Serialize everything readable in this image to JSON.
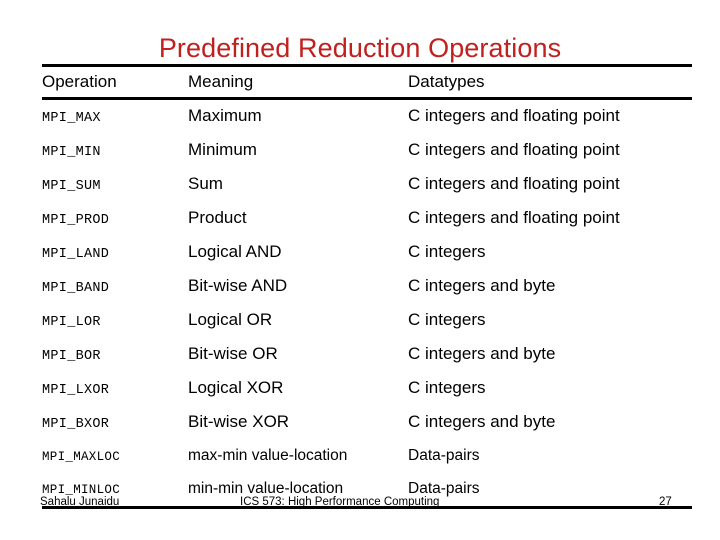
{
  "slide": {
    "title": "Predefined Reduction Operations",
    "title_color": "#C0201E",
    "text_color": "#000000",
    "background": "#FFFFFF"
  },
  "table": {
    "columns": [
      {
        "key": "operation",
        "label": "Operation"
      },
      {
        "key": "meaning",
        "label": "Meaning"
      },
      {
        "key": "datatypes",
        "label": "Datatypes"
      }
    ],
    "rows": [
      {
        "operation": "MPI_MAX",
        "meaning": "Maximum",
        "datatypes": "C integers and floating point"
      },
      {
        "operation": "MPI_MIN",
        "meaning": "Minimum",
        "datatypes": "C integers and floating point"
      },
      {
        "operation": "MPI_SUM",
        "meaning": "Sum",
        "datatypes": "C integers and floating point"
      },
      {
        "operation": "MPI_PROD",
        "meaning": "Product",
        "datatypes": "C integers and floating point"
      },
      {
        "operation": "MPI_LAND",
        "meaning": "Logical AND",
        "datatypes": "C integers"
      },
      {
        "operation": "MPI_BAND",
        "meaning": "Bit-wise AND",
        "datatypes": "C integers and byte"
      },
      {
        "operation": "MPI_LOR",
        "meaning": "Logical OR",
        "datatypes": "C integers"
      },
      {
        "operation": "MPI_BOR",
        "meaning": "Bit-wise OR",
        "datatypes": "C integers and byte"
      },
      {
        "operation": "MPI_LXOR",
        "meaning": "Logical XOR",
        "datatypes": "C integers"
      },
      {
        "operation": "MPI_BXOR",
        "meaning": "Bit-wise XOR",
        "datatypes": "C integers and byte"
      },
      {
        "operation": "MPI_MAXLOC",
        "meaning": "max-min value-location",
        "datatypes": "Data-pairs"
      },
      {
        "operation": "MPI_MINLOC",
        "meaning": "min-min value-location",
        "datatypes": "Data-pairs"
      }
    ]
  },
  "footer": {
    "author": "Sahalu Junaidu",
    "course": "ICS 573: High Performance Computing",
    "page_number": "27"
  }
}
